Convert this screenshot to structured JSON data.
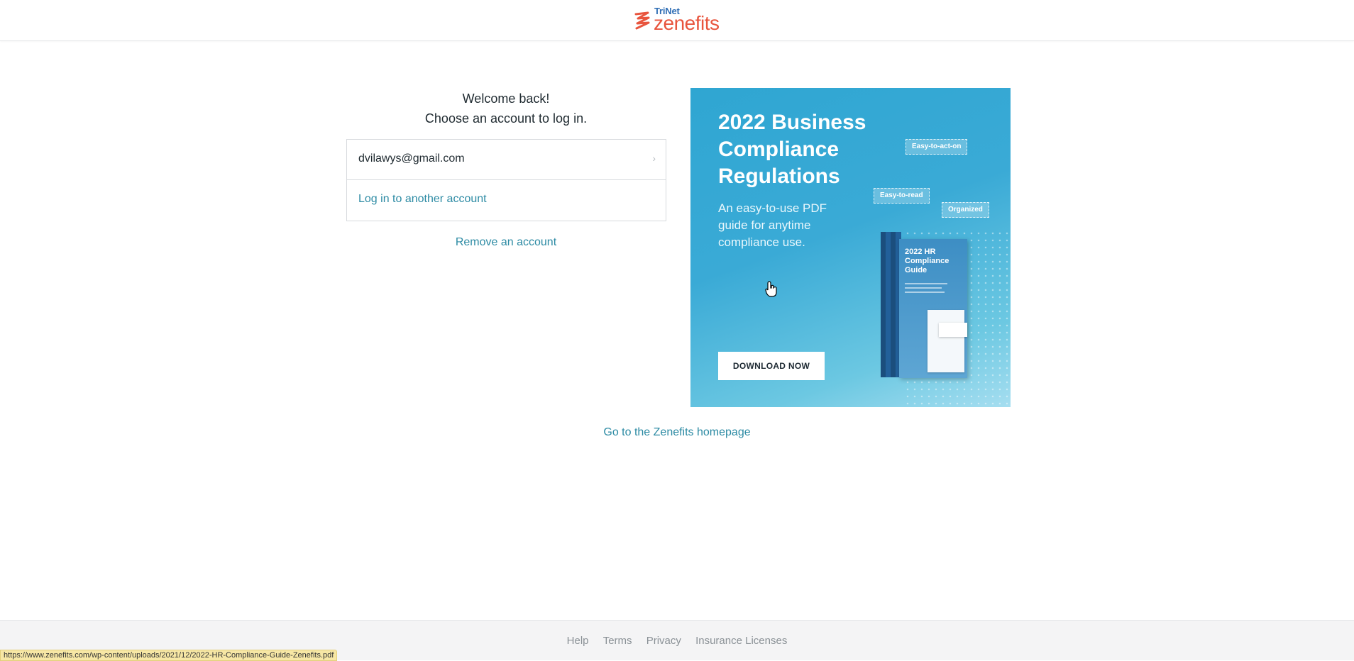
{
  "header": {
    "brand_top": "TriNet",
    "brand_main": "zenefits",
    "brand_color": "#e8553e",
    "brand_top_color": "#2f6eb5"
  },
  "login": {
    "welcome": "Welcome back!",
    "choose": "Choose an account to log in.",
    "account_email": "dvilawys@gmail.com",
    "other_account": "Log in to another account",
    "remove_account": "Remove an account",
    "link_color": "#2d8ba4"
  },
  "ad": {
    "title": "2022 Business Compliance Regulations",
    "subtitle": "An easy-to-use PDF guide for anytime compliance use.",
    "button": "DOWNLOAD NOW",
    "tags": [
      "Easy-to-act-on",
      "Easy-to-read",
      "Organized"
    ],
    "book_title": "2022 HR Compliance Guide",
    "background": "#35a8d4"
  },
  "homepage_link": "Go to the Zenefits homepage",
  "footer": {
    "links": [
      "Help",
      "Terms",
      "Privacy",
      "Insurance Licenses"
    ]
  },
  "status_bar": {
    "url": "https://www.zenefits.com/wp-content/uploads/2021/12/2022-HR-Compliance-Guide-Zenefits.pdf"
  }
}
